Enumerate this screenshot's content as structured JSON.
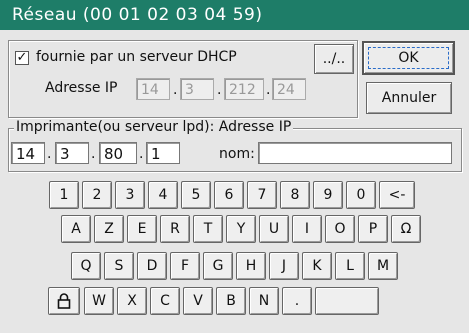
{
  "window": {
    "title": "Réseau (00 01 02 03 04 59)"
  },
  "dhcp": {
    "checked": true,
    "check_glyph": "✓",
    "label": "fournie par un serveur DHCP",
    "browse_label": "../..",
    "ip_label": "Adresse IP",
    "ip": [
      "14",
      "3",
      "212",
      "24"
    ]
  },
  "buttons": {
    "ok": "OK",
    "cancel": "Annuler"
  },
  "printer": {
    "legend": "Imprimante(ou serveur lpd): Adresse IP",
    "ip": [
      "14",
      "3",
      "80",
      "1"
    ],
    "name_label": "nom:",
    "name_value": ""
  },
  "dot": ".",
  "keyboard": {
    "row1": [
      "1",
      "2",
      "3",
      "4",
      "5",
      "6",
      "7",
      "8",
      "9",
      "0",
      "<-"
    ],
    "row2": [
      "A",
      "Z",
      "E",
      "R",
      "T",
      "Y",
      "U",
      "I",
      "O",
      "P",
      "Ω"
    ],
    "row3": [
      "Q",
      "S",
      "D",
      "F",
      "G",
      "H",
      "J",
      "K",
      "L",
      "M"
    ],
    "row4": [
      "W",
      "X",
      "C",
      "V",
      "B",
      "N",
      "."
    ],
    "lock_icon": "lock-icon"
  }
}
